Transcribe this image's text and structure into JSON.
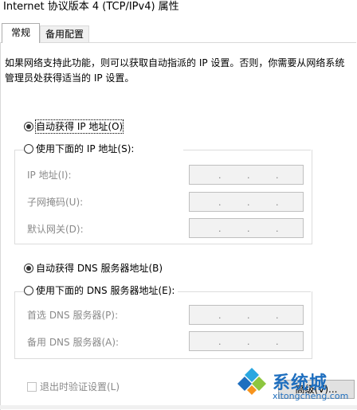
{
  "window": {
    "title": "Internet 协议版本 4 (TCP/IPv4) 属性"
  },
  "tabs": [
    {
      "label": "常规",
      "active": true
    },
    {
      "label": "备用配置",
      "active": false
    }
  ],
  "description": "如果网络支持此功能，则可以获取自动指派的 IP 设置。否则，你需要从网络系统管理员处获得适当的 IP 设置。",
  "ip_section": {
    "auto_label": "自动获得 IP 地址(O)",
    "auto_checked": true,
    "manual_label": "使用下面的 IP 地址(S):",
    "manual_checked": false,
    "fields": [
      {
        "label": "IP 地址(I):",
        "value": ""
      },
      {
        "label": "子网掩码(U):",
        "value": ""
      },
      {
        "label": "默认网关(D):",
        "value": ""
      }
    ]
  },
  "dns_section": {
    "auto_label": "自动获得 DNS 服务器地址(B)",
    "auto_checked": true,
    "manual_label": "使用下面的 DNS 服务器地址(E):",
    "manual_checked": false,
    "fields": [
      {
        "label": "首选 DNS 服务器(P):",
        "value": ""
      },
      {
        "label": "备用 DNS 服务器(A):",
        "value": ""
      }
    ]
  },
  "validate_on_exit": {
    "label": "退出时验证设置(L)",
    "checked": false
  },
  "advanced_button": "高级(V)...",
  "watermark": {
    "brand": "系统城",
    "url": "xitongcheng.com"
  },
  "colors": {
    "disabled_text": "#8a8a8a",
    "watermark_blue": "#1f6fbf"
  }
}
